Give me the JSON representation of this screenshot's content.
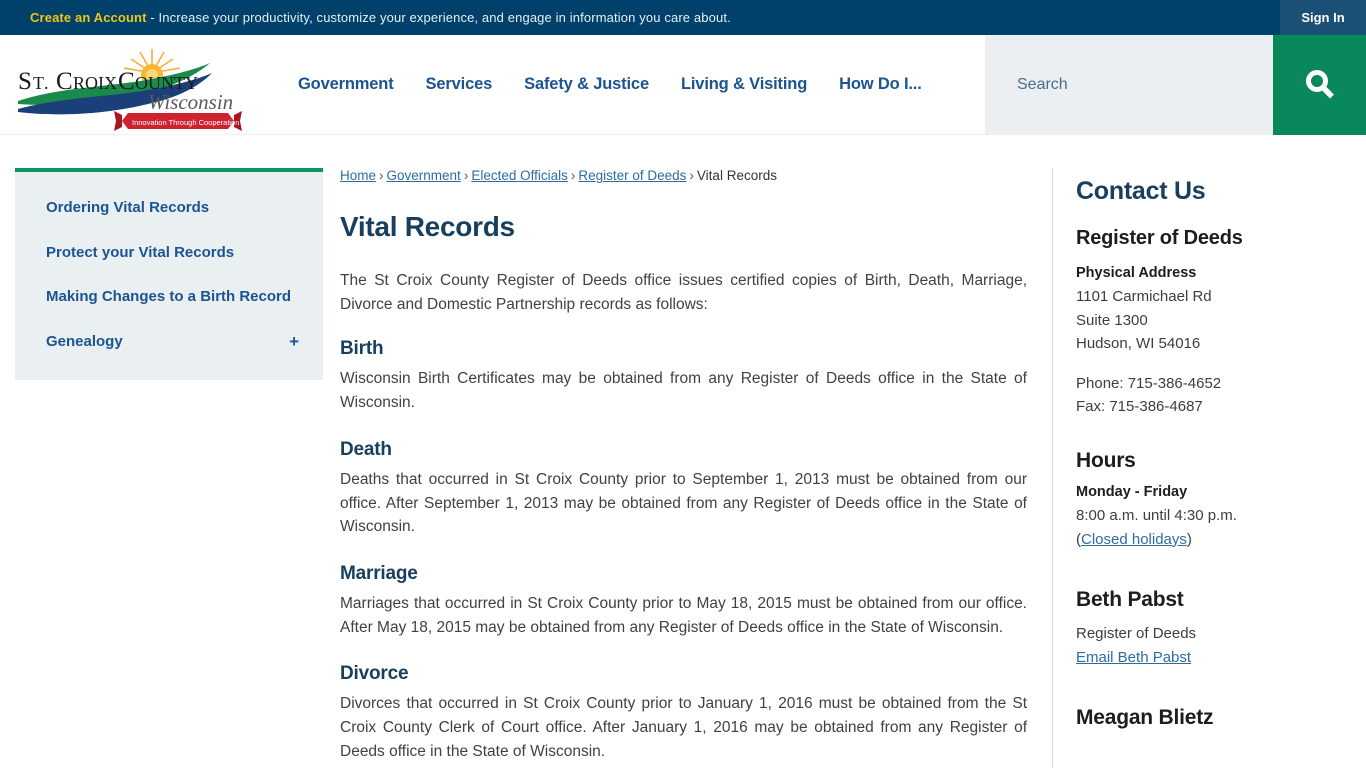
{
  "topbar": {
    "cta_label": "Create an Account",
    "message": " - Increase your productivity, customize your experience, and engage in information you care about.",
    "signin_label": "Sign In",
    "bg_color": "#00416b",
    "signin_bg_color": "#1b4f76",
    "cta_color": "#f0c419"
  },
  "logo": {
    "line1": "ST. CROIX COUNTY",
    "line2": "Wisconsin",
    "ribbon": "Innovation Through Cooperation"
  },
  "nav": {
    "items": [
      {
        "label": "Government"
      },
      {
        "label": "Services"
      },
      {
        "label": "Safety & Justice"
      },
      {
        "label": "Living & Visiting"
      },
      {
        "label": "How Do I..."
      }
    ],
    "link_color": "#1b5490"
  },
  "search": {
    "placeholder": "Search",
    "value": "",
    "button_color": "#09885c",
    "field_bg": "#eceff1"
  },
  "sidebar": {
    "accent_color": "#0b9464",
    "bg_color": "#eaeff2",
    "items": [
      {
        "label": "Ordering Vital Records",
        "expander": ""
      },
      {
        "label": "Protect your Vital Records",
        "expander": ""
      },
      {
        "label": "Making Changes to a Birth Record",
        "expander": ""
      },
      {
        "label": "Genealogy",
        "expander": "+"
      }
    ]
  },
  "breadcrumb": {
    "items": [
      {
        "label": "Home",
        "link": true
      },
      {
        "label": "Government",
        "link": true
      },
      {
        "label": "Elected Officials",
        "link": true
      },
      {
        "label": "Register of Deeds",
        "link": true
      },
      {
        "label": "Vital Records",
        "link": false
      }
    ],
    "separator": "›"
  },
  "main": {
    "title": "Vital Records",
    "intro": "The St Croix County Register of Deeds office issues certified copies of Birth, Death, Marriage, Divorce and Domestic Partnership records as follows:",
    "sections": [
      {
        "heading": "Birth",
        "body": "Wisconsin Birth Certificates may be obtained from any Register of Deeds office in the State of Wisconsin."
      },
      {
        "heading": "Death",
        "body": "Deaths that occurred in St Croix County prior to September 1, 2013 must be obtained from our office. After September 1, 2013 may be obtained from any Register of Deeds office in the State of Wisconsin."
      },
      {
        "heading": "Marriage",
        "body": "Marriages that occurred in St Croix County prior to May 18, 2015 must be obtained from our office. After May 18, 2015 may be obtained from any Register of Deeds office in the State of Wisconsin."
      },
      {
        "heading": "Divorce",
        "body": "Divorces that occurred in St Croix County prior to January 1, 2016 must be obtained from the St Croix County Clerk of Court office. After January 1, 2016 may be obtained from any Register of Deeds office in the State of Wisconsin."
      }
    ]
  },
  "contact": {
    "title": "Contact Us",
    "department": "Register of Deeds",
    "address_label": "Physical Address",
    "address_line1": "1101 Carmichael Rd",
    "address_line2": "Suite 1300",
    "address_line3": "Hudson, WI 54016",
    "phone": "Phone: 715-386-4652",
    "fax": "Fax: 715-386-4687",
    "hours_title": "Hours",
    "hours_days": "Monday - Friday",
    "hours_times": "8:00 a.m. until 4:30 p.m.",
    "holidays_open_paren": "(",
    "holidays_link": "Closed holidays",
    "holidays_close_paren": ")",
    "person1_name": "Beth Pabst",
    "person1_role": "Register of Deeds",
    "person1_email": "Email Beth Pabst",
    "person2_name": "Meagan Blietz"
  }
}
